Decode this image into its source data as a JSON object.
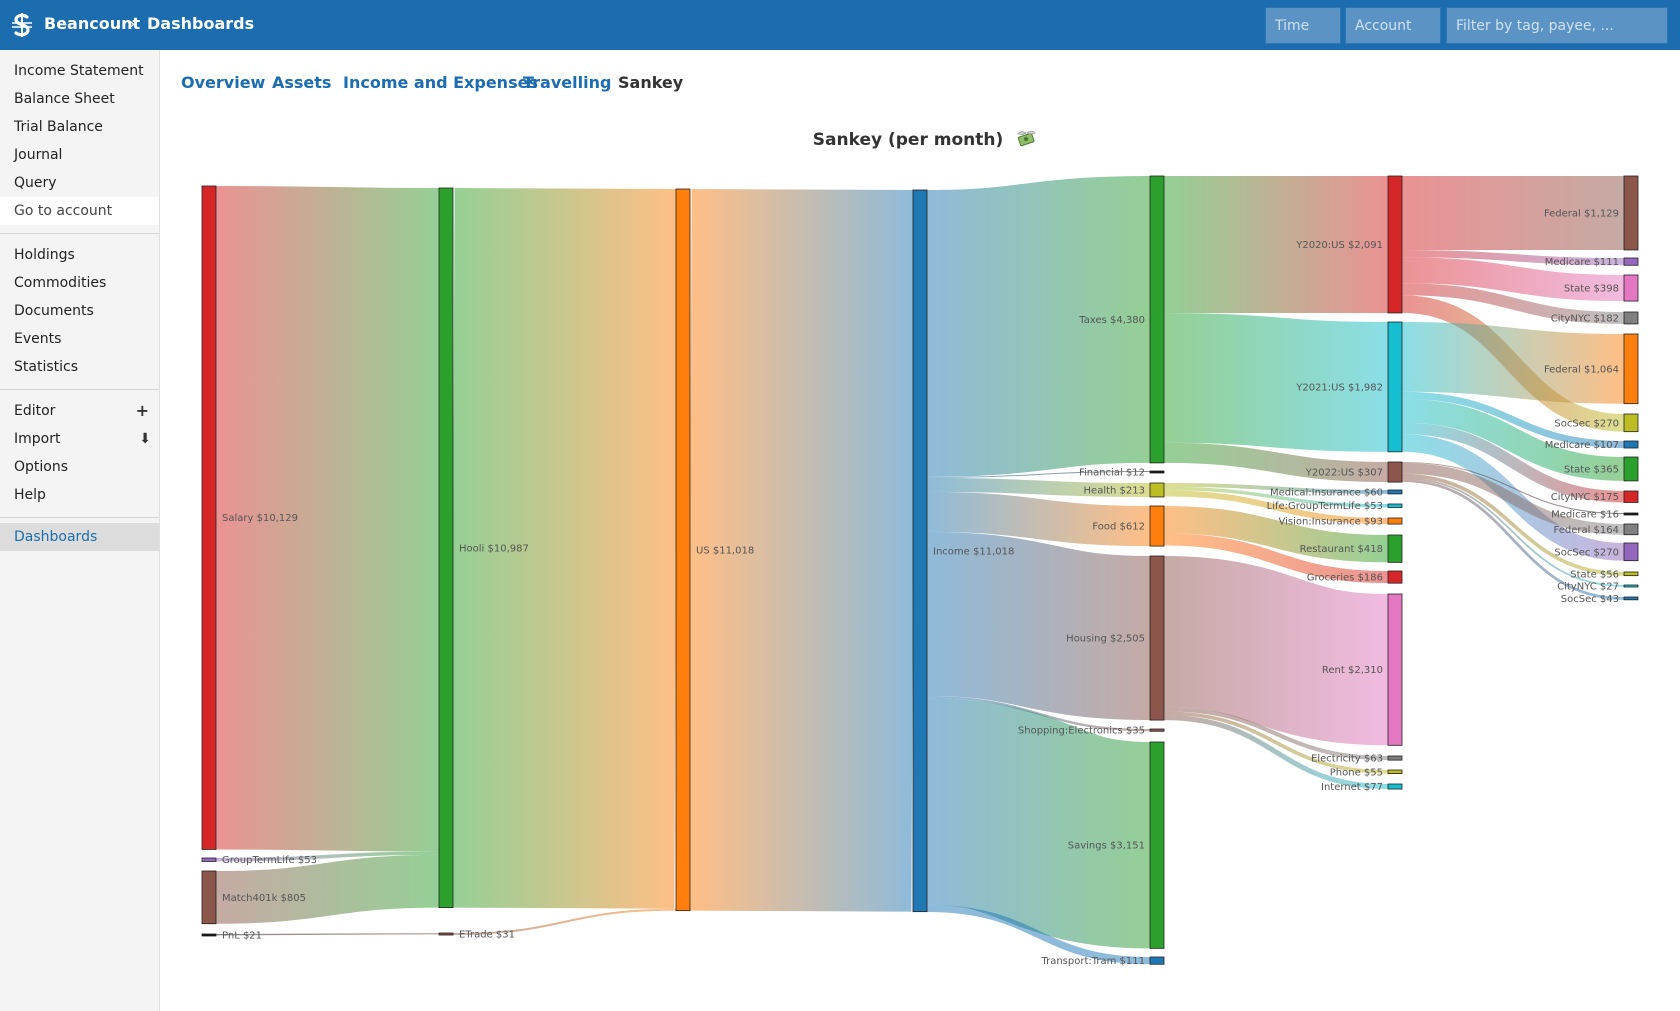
{
  "app": {
    "brand": "Beancount",
    "breadcrumb_sep": "›",
    "page": "Dashboards",
    "accent": "#1c6daf"
  },
  "header": {
    "time_placeholder": "Time",
    "account_placeholder": "Account",
    "filter_placeholder": "Filter by tag, payee, ..."
  },
  "sidebar": {
    "group1": [
      "Income Statement",
      "Balance Sheet",
      "Trial Balance",
      "Journal",
      "Query"
    ],
    "goto": "Go to account",
    "group2": [
      "Holdings",
      "Commodities",
      "Documents",
      "Events",
      "Statistics"
    ],
    "editor": "Editor",
    "import": "Import",
    "options": "Options",
    "help": "Help",
    "dashboards": "Dashboards"
  },
  "tabs": [
    "Overview",
    "Assets",
    "Income and Expenses",
    "Travelling",
    "Sankey"
  ],
  "chart_data": {
    "type": "sankey",
    "title": "Sankey (per month)",
    "unit": "USD",
    "nodes": [
      {
        "id": "salary",
        "label": "Salary $10,129",
        "value": 10129,
        "color": "#d62728"
      },
      {
        "id": "gtl",
        "label": "GroupTermLife $53",
        "value": 53,
        "color": "#9467bd"
      },
      {
        "id": "match",
        "label": "Match401k $805",
        "value": 805,
        "color": "#8c564b"
      },
      {
        "id": "pnl",
        "label": "PnL $21",
        "value": 21,
        "color": "#111111"
      },
      {
        "id": "hooli",
        "label": "Hooli $10,987",
        "value": 10987,
        "color": "#2ca02c"
      },
      {
        "id": "etrade",
        "label": "ETrade $31",
        "value": 31,
        "color": "#8c564b"
      },
      {
        "id": "us",
        "label": "US $11,018",
        "value": 11018,
        "color": "#ff7f0e"
      },
      {
        "id": "income",
        "label": "Income $11,018",
        "value": 11018,
        "color": "#1f77b4"
      },
      {
        "id": "taxes",
        "label": "Taxes $4,380",
        "value": 4380,
        "color": "#2ca02c"
      },
      {
        "id": "financial",
        "label": "Financial $12",
        "value": 12,
        "color": "#111111"
      },
      {
        "id": "health",
        "label": "Health $213",
        "value": 213,
        "color": "#bcbd22"
      },
      {
        "id": "food",
        "label": "Food $612",
        "value": 612,
        "color": "#ff7f0e"
      },
      {
        "id": "housing",
        "label": "Housing $2,505",
        "value": 2505,
        "color": "#8c564b"
      },
      {
        "id": "shopping",
        "label": "Shopping:Electronics $35",
        "value": 35,
        "color": "#8c564b"
      },
      {
        "id": "savings",
        "label": "Savings $3,151",
        "value": 3151,
        "color": "#2ca02c"
      },
      {
        "id": "transport",
        "label": "Transport:Tram $111",
        "value": 111,
        "color": "#1f77b4"
      },
      {
        "id": "y2020",
        "label": "Y2020:US $2,091",
        "value": 2091,
        "color": "#d62728"
      },
      {
        "id": "y2021",
        "label": "Y2021:US $1,982",
        "value": 1982,
        "color": "#17becf"
      },
      {
        "id": "y2022",
        "label": "Y2022:US $307",
        "value": 307,
        "color": "#8c564b"
      },
      {
        "id": "medins",
        "label": "Medical:Insurance $60",
        "value": 60,
        "color": "#1f77b4"
      },
      {
        "id": "lifegtl",
        "label": "Life:GroupTermLife $53",
        "value": 53,
        "color": "#17becf"
      },
      {
        "id": "visins",
        "label": "Vision:Insurance $93",
        "value": 93,
        "color": "#ff7f0e"
      },
      {
        "id": "restaurant",
        "label": "Restaurant $418",
        "value": 418,
        "color": "#2ca02c"
      },
      {
        "id": "groceries",
        "label": "Groceries $186",
        "value": 186,
        "color": "#d62728"
      },
      {
        "id": "rent",
        "label": "Rent $2,310",
        "value": 2310,
        "color": "#e377c2"
      },
      {
        "id": "electricity",
        "label": "Electricity $63",
        "value": 63,
        "color": "#7f7f7f"
      },
      {
        "id": "phone",
        "label": "Phone $55",
        "value": 55,
        "color": "#bcbd22"
      },
      {
        "id": "internet",
        "label": "Internet $77",
        "value": 77,
        "color": "#17becf"
      },
      {
        "id": "fed20",
        "label": "Federal $1,129",
        "value": 1129,
        "color": "#8c564b"
      },
      {
        "id": "med20",
        "label": "Medicare $111",
        "value": 111,
        "color": "#9467bd"
      },
      {
        "id": "state20",
        "label": "State $398",
        "value": 398,
        "color": "#e377c2"
      },
      {
        "id": "nyc20",
        "label": "CityNYC $182",
        "value": 182,
        "color": "#7f7f7f"
      },
      {
        "id": "fed21",
        "label": "Federal $1,064",
        "value": 1064,
        "color": "#ff7f0e"
      },
      {
        "id": "soc20",
        "label": "SocSec $270",
        "value": 270,
        "color": "#bcbd22"
      },
      {
        "id": "med21",
        "label": "Medicare $107",
        "value": 107,
        "color": "#1f77b4"
      },
      {
        "id": "state21",
        "label": "State $365",
        "value": 365,
        "color": "#2ca02c"
      },
      {
        "id": "nyc21",
        "label": "CityNYC $175",
        "value": 175,
        "color": "#d62728"
      },
      {
        "id": "med22",
        "label": "Medicare $16",
        "value": 16,
        "color": "#111111"
      },
      {
        "id": "fed22",
        "label": "Federal $164",
        "value": 164,
        "color": "#7f7f7f"
      },
      {
        "id": "soc21",
        "label": "SocSec $270",
        "value": 270,
        "color": "#9467bd"
      },
      {
        "id": "state22",
        "label": "State $56",
        "value": 56,
        "color": "#bcbd22"
      },
      {
        "id": "nyc22",
        "label": "CityNYC $27",
        "value": 27,
        "color": "#17becf"
      },
      {
        "id": "soc22",
        "label": "SocSec $43",
        "value": 43,
        "color": "#1f77b4"
      }
    ],
    "links": [
      {
        "source": "salary",
        "target": "hooli",
        "value": 10129
      },
      {
        "source": "gtl",
        "target": "hooli",
        "value": 53
      },
      {
        "source": "match",
        "target": "hooli",
        "value": 805
      },
      {
        "source": "pnl",
        "target": "etrade",
        "value": 21
      },
      {
        "source": "hooli",
        "target": "us",
        "value": 10987
      },
      {
        "source": "etrade",
        "target": "us",
        "value": 31
      },
      {
        "source": "us",
        "target": "income",
        "value": 11018
      },
      {
        "source": "income",
        "target": "taxes",
        "value": 4380
      },
      {
        "source": "income",
        "target": "financial",
        "value": 12
      },
      {
        "source": "income",
        "target": "health",
        "value": 213
      },
      {
        "source": "income",
        "target": "food",
        "value": 612
      },
      {
        "source": "income",
        "target": "housing",
        "value": 2505
      },
      {
        "source": "income",
        "target": "shopping",
        "value": 35
      },
      {
        "source": "income",
        "target": "savings",
        "value": 3151
      },
      {
        "source": "income",
        "target": "transport",
        "value": 111
      },
      {
        "source": "taxes",
        "target": "y2020",
        "value": 2091
      },
      {
        "source": "taxes",
        "target": "y2021",
        "value": 1982
      },
      {
        "source": "taxes",
        "target": "y2022",
        "value": 307
      },
      {
        "source": "health",
        "target": "medins",
        "value": 60
      },
      {
        "source": "health",
        "target": "lifegtl",
        "value": 53
      },
      {
        "source": "health",
        "target": "visins",
        "value": 93
      },
      {
        "source": "food",
        "target": "restaurant",
        "value": 418
      },
      {
        "source": "food",
        "target": "groceries",
        "value": 186
      },
      {
        "source": "housing",
        "target": "rent",
        "value": 2310
      },
      {
        "source": "housing",
        "target": "electricity",
        "value": 63
      },
      {
        "source": "housing",
        "target": "phone",
        "value": 55
      },
      {
        "source": "housing",
        "target": "internet",
        "value": 77
      },
      {
        "source": "y2020",
        "target": "fed20",
        "value": 1129
      },
      {
        "source": "y2020",
        "target": "med20",
        "value": 111
      },
      {
        "source": "y2020",
        "target": "state20",
        "value": 398
      },
      {
        "source": "y2020",
        "target": "nyc20",
        "value": 182
      },
      {
        "source": "y2020",
        "target": "soc20",
        "value": 270
      },
      {
        "source": "y2021",
        "target": "fed21",
        "value": 1064
      },
      {
        "source": "y2021",
        "target": "med21",
        "value": 107
      },
      {
        "source": "y2021",
        "target": "state21",
        "value": 365
      },
      {
        "source": "y2021",
        "target": "nyc21",
        "value": 175
      },
      {
        "source": "y2021",
        "target": "soc21",
        "value": 270
      },
      {
        "source": "y2022",
        "target": "med22",
        "value": 16
      },
      {
        "source": "y2022",
        "target": "fed22",
        "value": 164
      },
      {
        "source": "y2022",
        "target": "state22",
        "value": 56
      },
      {
        "source": "y2022",
        "target": "nyc22",
        "value": 27
      },
      {
        "source": "y2022",
        "target": "soc22",
        "value": 43
      }
    ]
  }
}
